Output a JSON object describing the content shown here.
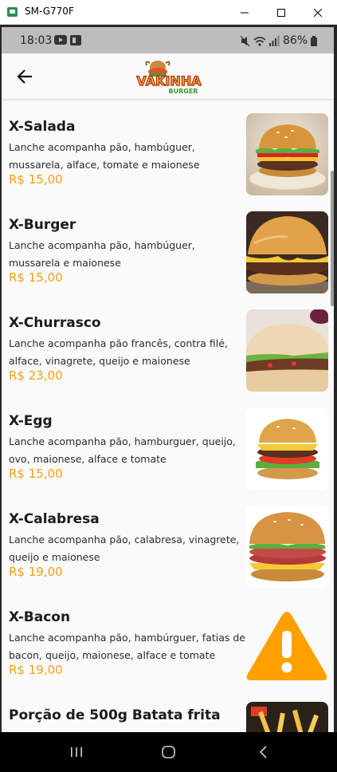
{
  "window": {
    "title": "SM-G770F"
  },
  "status_bar": {
    "time": "18:03",
    "battery": "86%"
  },
  "app_bar": {
    "logo_text_main": "VAKINHA",
    "logo_text_sub": "BURGER"
  },
  "menu": [
    {
      "name": "X-Salada",
      "description": "Lanche acompanha pão, hambúguer, mussarela, alface, tomate e maionese",
      "price": "R$ 15,00",
      "image": "burger-salad-photo"
    },
    {
      "name": "X-Burger",
      "description": "Lanche acompanha pão, hambúguer, mussarela e maionese",
      "price": "R$ 15,00",
      "image": "burger-cheese-photo"
    },
    {
      "name": "X-Churrasco",
      "description": "Lanche acompanha pão francês, contra filé, alface, vinagrete, queijo e maionese",
      "price": "R$ 23,00",
      "image": "steak-sandwich-photo"
    },
    {
      "name": "X-Egg",
      "description": "Lanche acompanha pão, hamburguer, queijo, ovo, maionese, alface e tomate",
      "price": "R$ 15,00",
      "image": "burger-egg-photo"
    },
    {
      "name": "X-Calabresa",
      "description": "Lanche acompanha pão, calabresa, vinagrete, queijo e maionese",
      "price": "R$ 19,00",
      "image": "burger-calabresa-photo"
    },
    {
      "name": "X-Bacon",
      "description": "Lanche acompanha pão, hambúrguer, fatias de bacon, queijo, maionese, alface e tomate",
      "price": "R$ 19,00",
      "image": "warning-icon"
    },
    {
      "name": "Porção de 500g Batata frita",
      "description": "",
      "price": "",
      "image": "fries-photo"
    }
  ],
  "colors": {
    "price": "#f5a013",
    "warning": "#ffa000",
    "status_bar": "#bdbdbd",
    "nav_bar": "#000000"
  }
}
